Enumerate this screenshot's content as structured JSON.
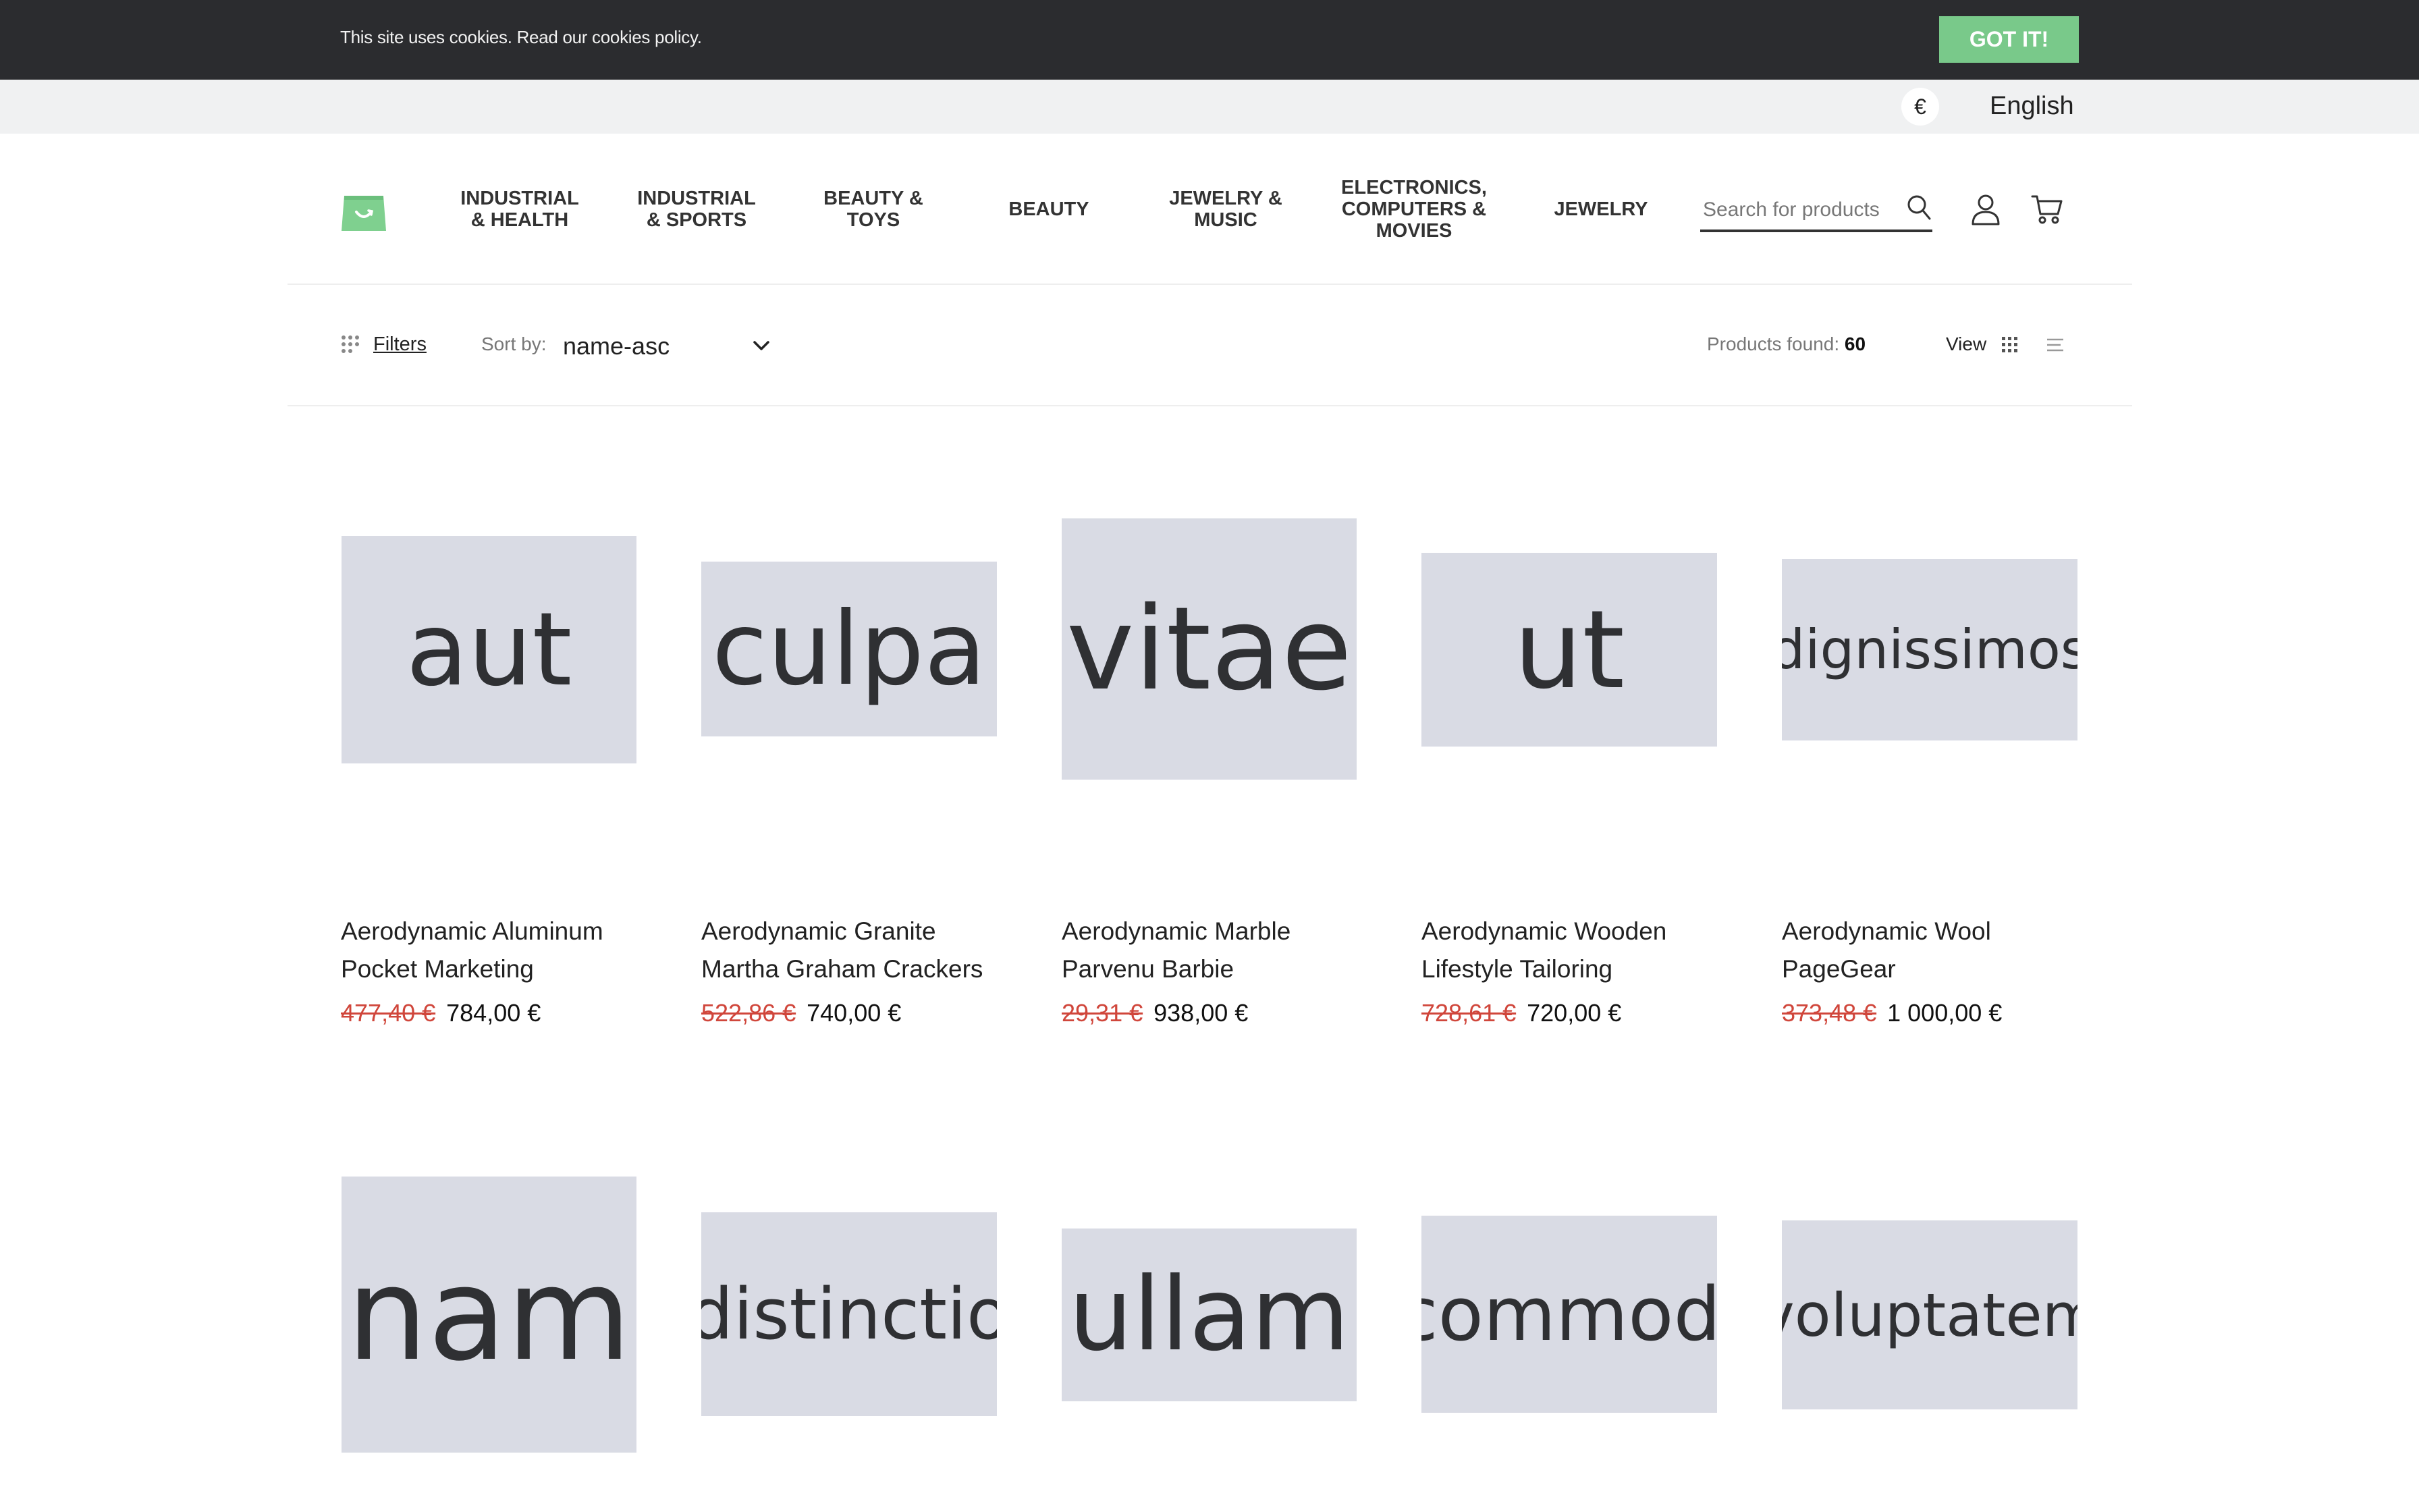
{
  "cookie": {
    "text": "This site uses cookies. Read our cookies policy.",
    "button": "GOT IT!"
  },
  "topbar": {
    "currency": "€",
    "language": "English"
  },
  "header": {
    "nav": [
      {
        "label": "INDUSTRIAL & HEALTH"
      },
      {
        "label": "INDUSTRIAL & SPORTS"
      },
      {
        "label": "BEAUTY & TOYS"
      },
      {
        "label": "BEAUTY"
      },
      {
        "label": "JEWELRY & MUSIC"
      },
      {
        "label": "ELECTRONICS, COMPUTERS & MOVIES"
      },
      {
        "label": "JEWELRY"
      }
    ],
    "search_placeholder": "Search for products"
  },
  "toolbar": {
    "filters": "Filters",
    "sort_label": "Sort by:",
    "sort_value": "name-asc",
    "found_label": "Products found:",
    "found_count": "60",
    "view_label": "View"
  },
  "products": [
    {
      "image_text": "aut",
      "title": "Aerodynamic Aluminum Pocket Marketing",
      "old_price": "477,40 €",
      "price": "784,00 €"
    },
    {
      "image_text": "culpa",
      "title": "Aerodynamic Granite Martha Graham Crackers",
      "old_price": "522,86 €",
      "price": "740,00 €"
    },
    {
      "image_text": "vitae",
      "title": "Aerodynamic Marble Parvenu Barbie",
      "old_price": "29,31 €",
      "price": "938,00 €"
    },
    {
      "image_text": "ut",
      "title": "Aerodynamic Wooden Lifestyle Tailoring",
      "old_price": "728,61 €",
      "price": "720,00 €"
    },
    {
      "image_text": "dignissimos",
      "title": "Aerodynamic Wool PageGear",
      "old_price": "373,48 €",
      "price": "1 000,00 €"
    },
    {
      "image_text": "nam"
    },
    {
      "image_text": "distinctio"
    },
    {
      "image_text": "ullam"
    },
    {
      "image_text": "commodi"
    },
    {
      "image_text": "voluptatem"
    }
  ],
  "colors": {
    "cookie_bar": "#2b2c2f",
    "accent_green": "#79c98a",
    "old_price_red": "#d0463b",
    "placeholder_bg": "#d9dbe4"
  }
}
